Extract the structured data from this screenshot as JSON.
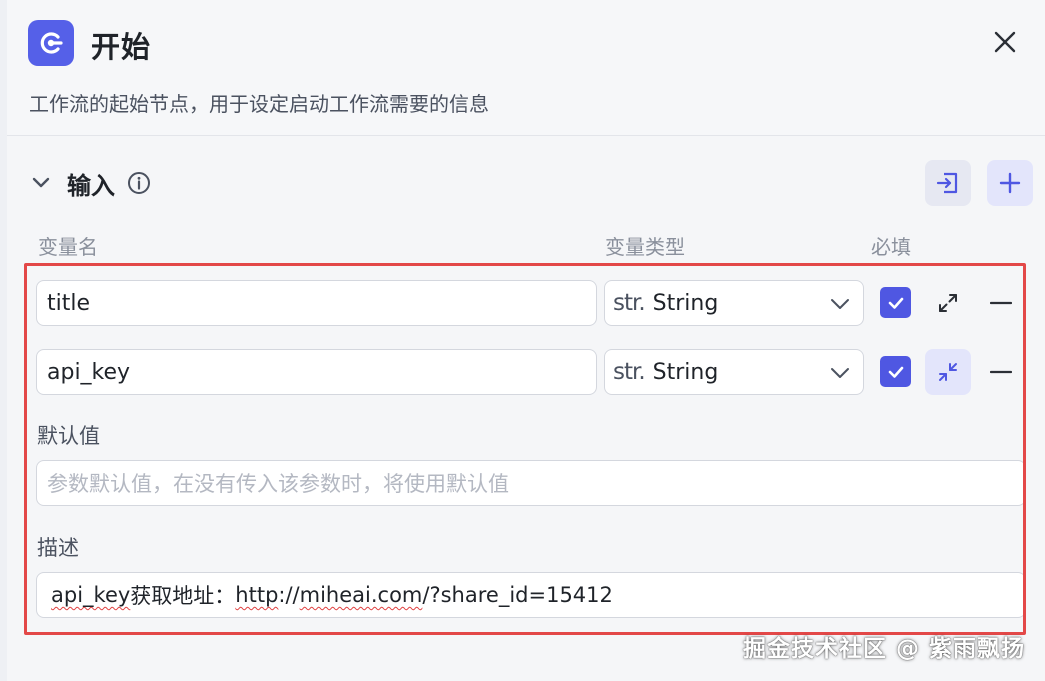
{
  "header": {
    "title": "开始",
    "description": "工作流的起始节点，用于设定启动工作流需要的信息",
    "app_icon": "start-node-icon",
    "close_icon": "close-icon"
  },
  "inputs_section": {
    "title": "输入",
    "columns": {
      "name": "变量名",
      "type": "变量类型",
      "required": "必填"
    },
    "variables": [
      {
        "name": "title",
        "type_prefix": "str.",
        "type": "String",
        "required": true,
        "expanded": false
      },
      {
        "name": "api_key",
        "type_prefix": "str.",
        "type": "String",
        "required": true,
        "expanded": true
      }
    ],
    "detail": {
      "default_label": "默认值",
      "default_placeholder": "参数默认值，在没有传入该参数时，将使用默认值",
      "desc_label": "描述",
      "desc_text_a": "api_key",
      "desc_text_b": "获取地址：",
      "desc_text_c": "http",
      "desc_text_d": "://",
      "desc_text_e": "miheai.com",
      "desc_text_f": "/?share_id=15412"
    }
  },
  "watermark": "掘金技术社区 @ 紫雨飘扬",
  "colors": {
    "accent": "#4f57e2",
    "highlight_border": "#e34848",
    "panel_bg": "#f5f6f8"
  }
}
